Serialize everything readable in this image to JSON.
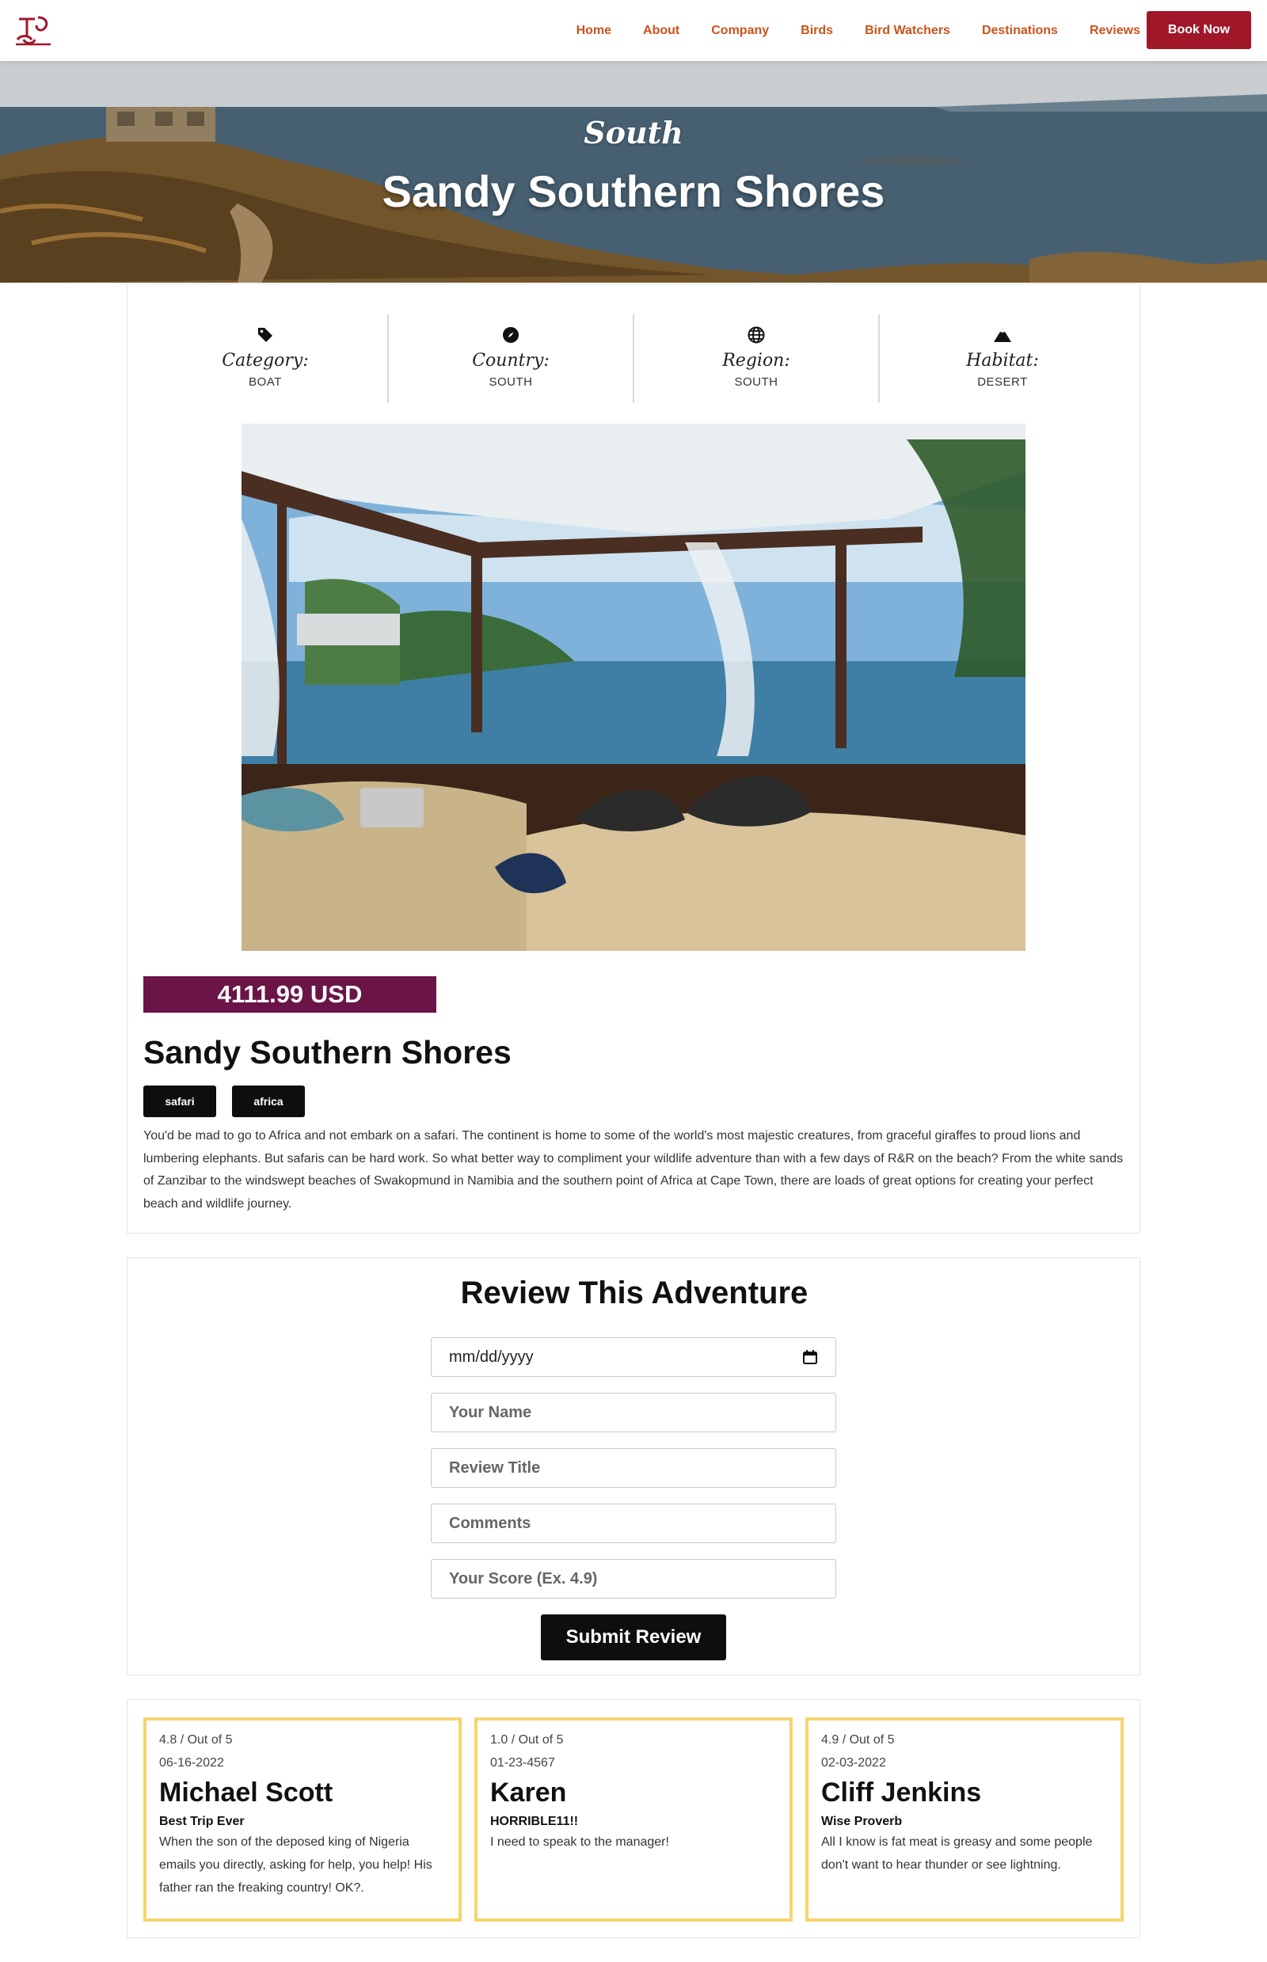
{
  "nav": {
    "links": [
      "Home",
      "About",
      "Company",
      "Birds",
      "Bird Watchers",
      "Destinations",
      "Reviews"
    ],
    "book_label": "Book Now",
    "accent": "#c9541c",
    "book_color": "#a0172a"
  },
  "hero": {
    "subtitle": "South",
    "title": "Sandy Southern Shores"
  },
  "facts": [
    {
      "icon": "tag-icon",
      "label": "Category:",
      "value": "BOAT"
    },
    {
      "icon": "compass-icon",
      "label": "Country:",
      "value": "SOUTH"
    },
    {
      "icon": "globe-icon",
      "label": "Region:",
      "value": "SOUTH"
    },
    {
      "icon": "mountain-icon",
      "label": "Habitat:",
      "value": "DESERT"
    }
  ],
  "detail": {
    "price": "4111.99 USD",
    "price_color": "#6a1447",
    "title": "Sandy Southern Shores",
    "tags": [
      "safari",
      "africa"
    ],
    "description": "You'd be mad to go to Africa and not embark on a safari. The continent is home to some of the world's most majestic creatures, from graceful giraffes to proud lions and lumbering elephants. But safaris can be hard work. So what better way to compliment your wildlife adventure than with a few days of R&R on the beach? From the white sands of Zanzibar to the windswept beaches of Swakopmund in Namibia and the southern point of Africa at Cape Town, there are loads of great options for creating your perfect beach and wildlife journey."
  },
  "form": {
    "title": "Review This Adventure",
    "date_value": "mm/dd/yyyy",
    "name_placeholder": "Your Name",
    "review_title_placeholder": "Review Title",
    "comments_placeholder": "Comments",
    "score_placeholder": "Your Score (Ex. 4.9)",
    "submit_label": "Submit Review"
  },
  "reviews": [
    {
      "score": "4.8 / Out of 5",
      "date": "06-16-2022",
      "name": "Michael Scott",
      "title": "Best Trip Ever",
      "body": "When the son of the deposed king of Nigeria emails you directly, asking for help, you help! His father ran the freaking country! OK?."
    },
    {
      "score": "1.0 / Out of 5",
      "date": "01-23-4567",
      "name": "Karen",
      "title": "HORRIBLE11!!",
      "body": "I need to speak to the manager!"
    },
    {
      "score": "4.9 / Out of 5",
      "date": "02-03-2022",
      "name": "Cliff Jenkins",
      "title": "Wise Proverb",
      "body": "All I know is fat meat is greasy and some people don't want to hear thunder or see lightning."
    }
  ],
  "review_border_color": "#f6d46f"
}
